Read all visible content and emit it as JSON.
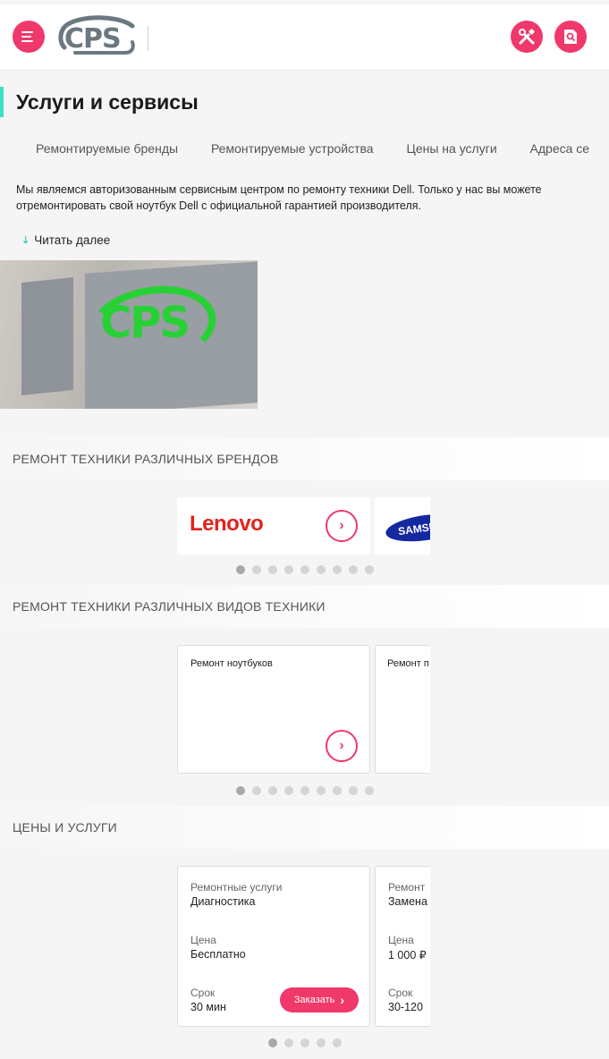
{
  "header": {
    "logo_text": "CPS",
    "menu_icon": "hamburger-icon",
    "tools_icon": "tools-icon",
    "search_icon": "search-icon"
  },
  "page": {
    "title": "Услуги и сервисы",
    "tabs": [
      "Ремонтируемые бренды",
      "Ремонтируемые устройства",
      "Цены на услуги",
      "Адреса се"
    ],
    "intro": "Мы являемся авторизованным сервисным центром по ремонту техники Dell. Только у нас вы можете отремонтировать свой ноутбук Dell с официальной гарантией производителя.",
    "read_more": "Читать далее",
    "photo_logo": "CPS"
  },
  "brands": {
    "title": "РЕМОНТ ТЕХНИКИ РАЗЛИЧНЫХ БРЕНДОВ",
    "items": [
      "Lenovo",
      "SAMSUNG"
    ],
    "dots": 9,
    "active_dot": 0
  },
  "types": {
    "title": "РЕМОНТ ТЕХНИКИ РАЗЛИЧНЫХ ВИДОВ ТЕХНИКИ",
    "items": [
      "Ремонт ноутбуков",
      "Ремонт п"
    ],
    "dots": 9,
    "active_dot": 0
  },
  "prices": {
    "title": "ЦЕНЫ И УСЛУГИ",
    "service_label": "Ремонтные услуги",
    "price_label": "Цена",
    "term_label": "Срок",
    "order_label": "Заказать",
    "cards": [
      {
        "service_label": "Ремонтные услуги",
        "service": "Диагностика",
        "price_label": "Цена",
        "price": "Бесплатно",
        "term_label": "Срок",
        "term": "30 мин"
      },
      {
        "service_label": "Ремонт",
        "service": "Замена",
        "price_label": "Цена",
        "price": "1 000 ₽",
        "term_label": "Срок",
        "term": "30-120"
      }
    ],
    "dots": 5,
    "active_dot": 0
  },
  "colors": {
    "accent": "#f0386b",
    "title_bar": "#3ee0c8",
    "logo_gray": "#6b7880",
    "sign_green": "#27d135"
  }
}
